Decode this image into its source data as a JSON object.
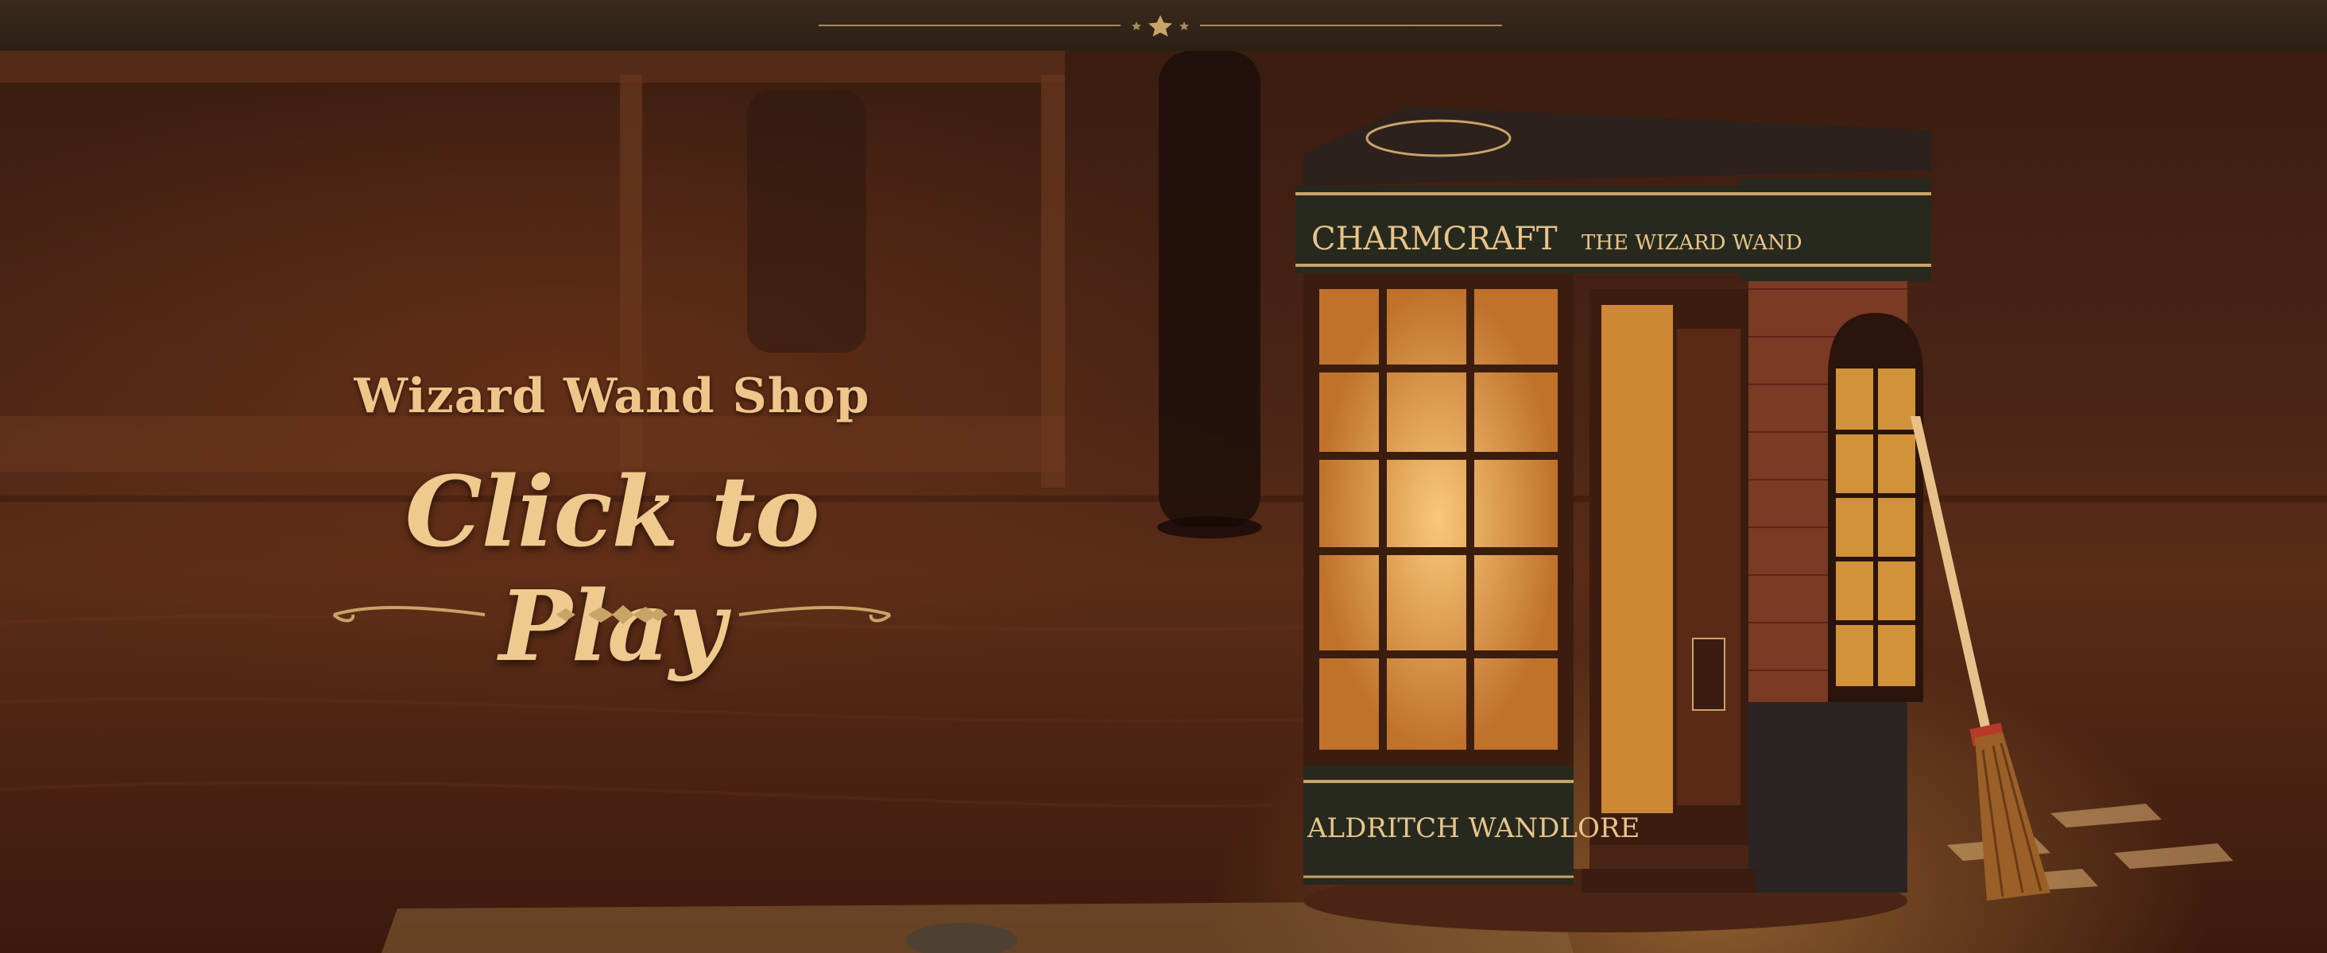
{
  "hero": {
    "subtitle": "Wizard Wand Shop",
    "cta_label": "Click to Play"
  },
  "product": {
    "sign_left": "CHARMCRAFT",
    "sign_right": "THE WIZARD WAND",
    "sign_bottom": "ALDRITCH WANDLORE"
  },
  "colors": {
    "top_bar": "#2c1f14",
    "gold_accent": "#c9a468",
    "headline": "#f0c98e",
    "wood": "#3b1d10",
    "shop_sign": "#27291e",
    "brick": "#7a3a24"
  },
  "icons": [
    "star-icon",
    "ornamental-divider",
    "broom"
  ]
}
